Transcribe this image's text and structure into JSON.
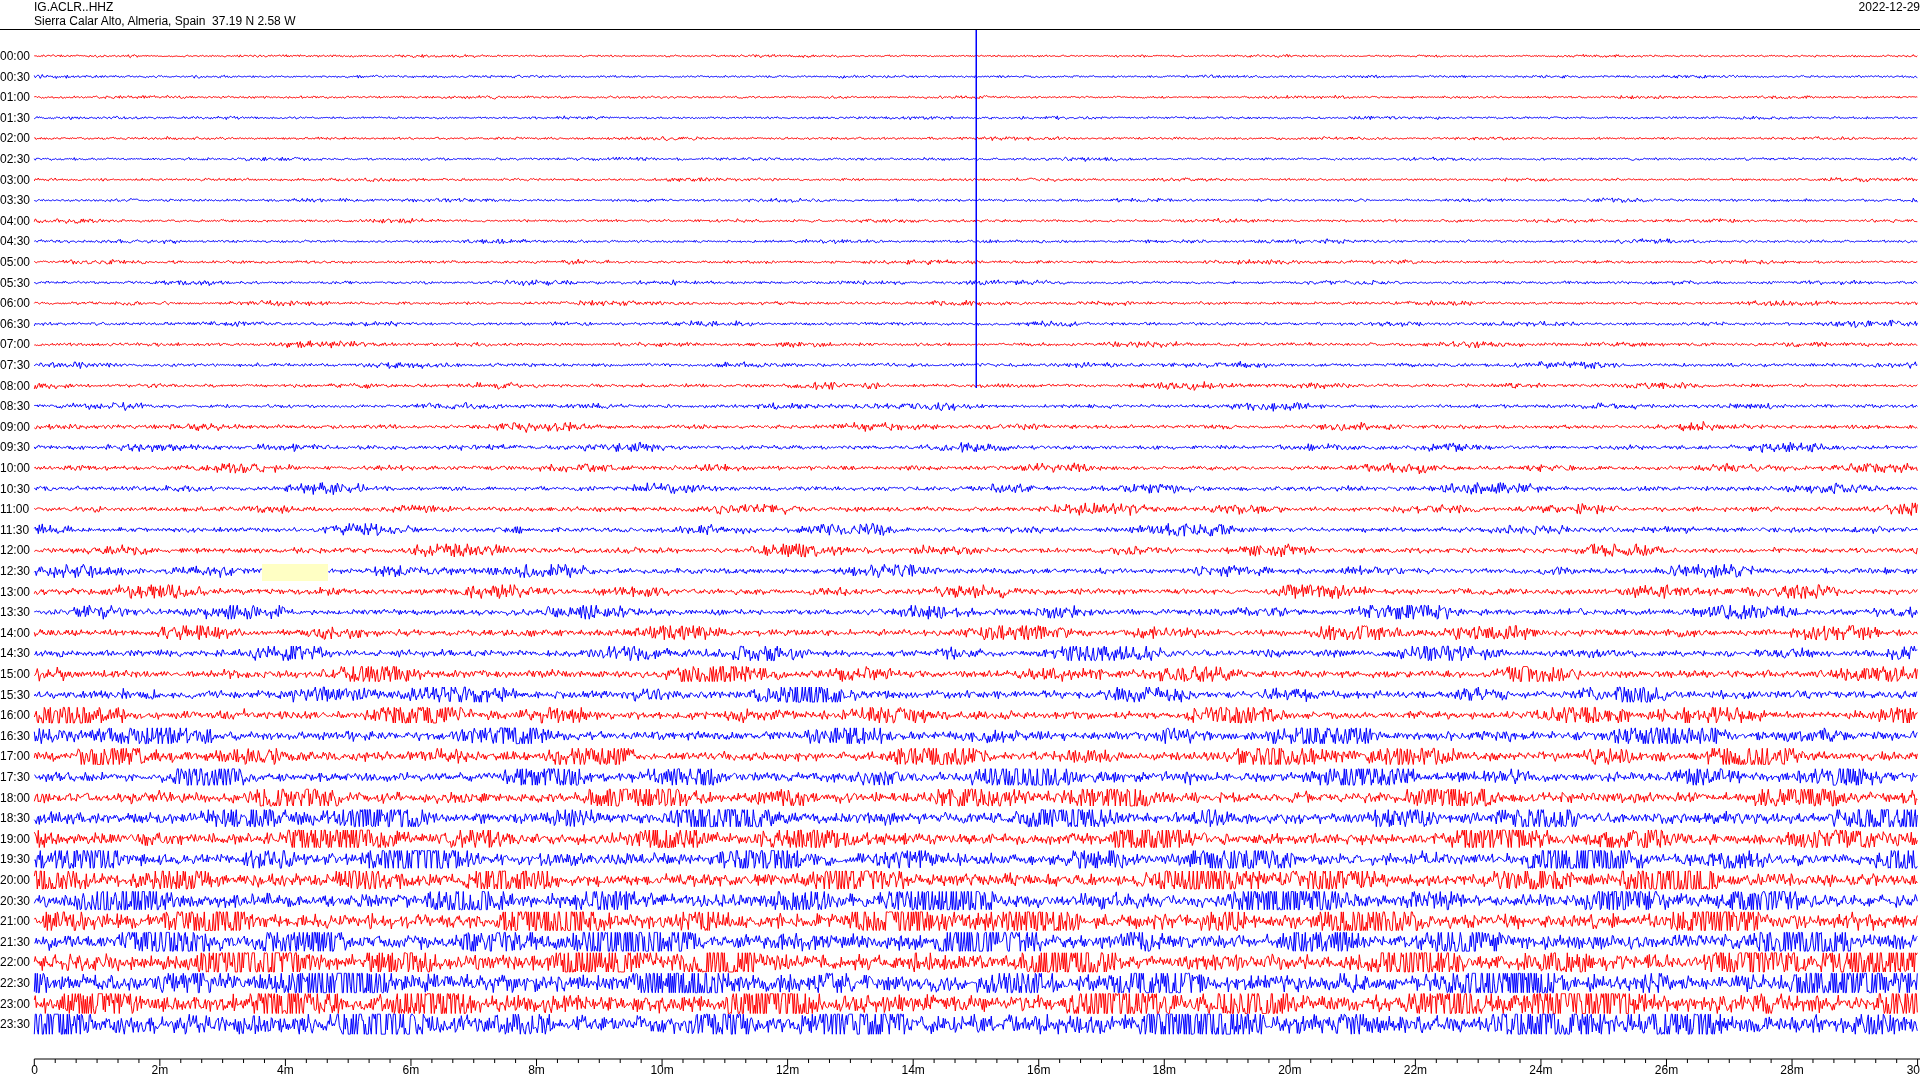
{
  "header": {
    "station": "IG.ACLR..HHZ",
    "location": "Sierra Calar Alto, Almeria, Spain  37.19 N 2.58 W",
    "date": "2022-12-29"
  },
  "event_line": true,
  "traces": [
    {
      "label": "00:00",
      "color": "#ff0000",
      "gap": false
    },
    {
      "label": "00:30",
      "color": "#0000ff",
      "gap": false
    },
    {
      "label": "01:00",
      "color": "#ff0000",
      "gap": false
    },
    {
      "label": "01:30",
      "color": "#0000ff",
      "gap": false
    },
    {
      "label": "02:00",
      "color": "#ff0000",
      "gap": false
    },
    {
      "label": "02:30",
      "color": "#0000ff",
      "gap": false
    },
    {
      "label": "03:00",
      "color": "#ff0000",
      "gap": false
    },
    {
      "label": "03:30",
      "color": "#0000ff",
      "gap": false
    },
    {
      "label": "04:00",
      "color": "#ff0000",
      "gap": false
    },
    {
      "label": "04:30",
      "color": "#0000ff",
      "gap": false
    },
    {
      "label": "05:00",
      "color": "#ff0000",
      "gap": false
    },
    {
      "label": "05:30",
      "color": "#0000ff",
      "gap": false
    },
    {
      "label": "06:00",
      "color": "#ff0000",
      "gap": false
    },
    {
      "label": "06:30",
      "color": "#0000ff",
      "gap": false
    },
    {
      "label": "07:00",
      "color": "#ff0000",
      "gap": false
    },
    {
      "label": "07:30",
      "color": "#0000ff",
      "gap": false
    },
    {
      "label": "08:00",
      "color": "#ff0000",
      "gap": false
    },
    {
      "label": "08:30",
      "color": "#0000ff",
      "gap": false
    },
    {
      "label": "09:00",
      "color": "#ff0000",
      "gap": false
    },
    {
      "label": "09:30",
      "color": "#0000ff",
      "gap": false
    },
    {
      "label": "10:00",
      "color": "#ff0000",
      "gap": false
    },
    {
      "label": "10:30",
      "color": "#0000ff",
      "gap": false
    },
    {
      "label": "11:00",
      "color": "#ff0000",
      "gap": false
    },
    {
      "label": "11:30",
      "color": "#0000ff",
      "gap": false
    },
    {
      "label": "12:00",
      "color": "#ff0000",
      "gap": false
    },
    {
      "label": "12:30",
      "color": "#0000ff",
      "gap": true
    },
    {
      "label": "13:00",
      "color": "#ff0000",
      "gap": false
    },
    {
      "label": "13:30",
      "color": "#0000ff",
      "gap": false
    },
    {
      "label": "14:00",
      "color": "#ff0000",
      "gap": false
    },
    {
      "label": "14:30",
      "color": "#0000ff",
      "gap": false
    },
    {
      "label": "15:00",
      "color": "#ff0000",
      "gap": false
    },
    {
      "label": "15:30",
      "color": "#0000ff",
      "gap": false
    },
    {
      "label": "16:00",
      "color": "#ff0000",
      "gap": false
    },
    {
      "label": "16:30",
      "color": "#0000ff",
      "gap": false
    },
    {
      "label": "17:00",
      "color": "#ff0000",
      "gap": false
    },
    {
      "label": "17:30",
      "color": "#0000ff",
      "gap": false
    },
    {
      "label": "18:00",
      "color": "#ff0000",
      "gap": false
    },
    {
      "label": "18:30",
      "color": "#0000ff",
      "gap": false
    },
    {
      "label": "19:00",
      "color": "#ff0000",
      "gap": false
    },
    {
      "label": "19:30",
      "color": "#0000ff",
      "gap": false
    },
    {
      "label": "20:00",
      "color": "#ff0000",
      "gap": false
    },
    {
      "label": "20:30",
      "color": "#0000ff",
      "gap": false
    },
    {
      "label": "21:00",
      "color": "#ff0000",
      "gap": false
    },
    {
      "label": "21:30",
      "color": "#0000ff",
      "gap": false
    },
    {
      "label": "22:00",
      "color": "#ff0000",
      "gap": false
    },
    {
      "label": "22:30",
      "color": "#0000ff",
      "gap": false
    },
    {
      "label": "23:00",
      "color": "#ff0000",
      "gap": false
    },
    {
      "label": "23:30",
      "color": "#0000ff",
      "gap": false
    }
  ],
  "x_axis": {
    "tick_labels": [
      "0",
      "2m",
      "4m",
      "6m",
      "8m",
      "10m",
      "12m",
      "14m",
      "16m",
      "18m",
      "20m",
      "22m",
      "24m",
      "26m",
      "28m",
      "30"
    ]
  }
}
